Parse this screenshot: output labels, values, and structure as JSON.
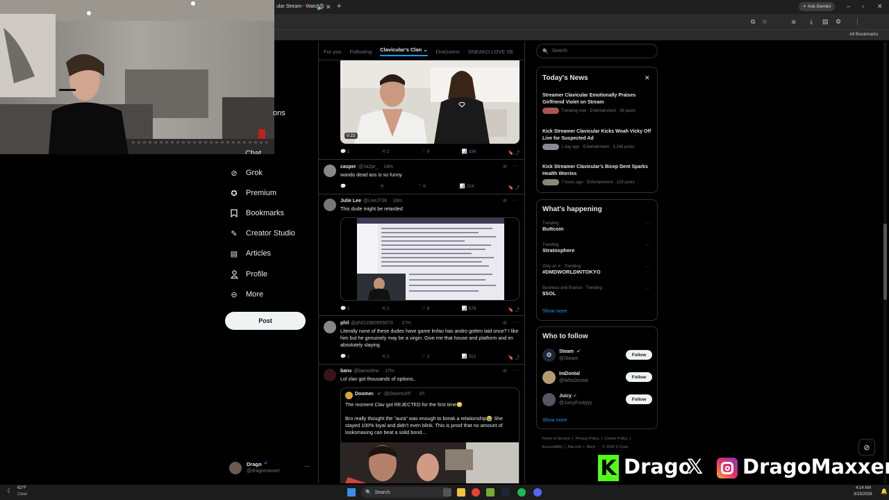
{
  "browser": {
    "tab_title": "ular Stream - Watch L",
    "ask_gemini": "Ask Gemini",
    "all_bookmarks": "All Bookmarks"
  },
  "sidebar": {
    "partial_item": "ons",
    "partial_item2": "Chat",
    "items": [
      {
        "label": "Grok",
        "icon": "grok-icon"
      },
      {
        "label": "Premium",
        "icon": "premium-icon"
      },
      {
        "label": "Bookmarks",
        "icon": "bookmark-icon"
      },
      {
        "label": "Creator Studio",
        "icon": "creator-studio-icon"
      },
      {
        "label": "Articles",
        "icon": "articles-icon"
      },
      {
        "label": "Profile",
        "icon": "profile-icon"
      },
      {
        "label": "More",
        "icon": "more-icon"
      }
    ],
    "post_label": "Post",
    "account": {
      "name": "Drago",
      "handle": "@dragomaxxer"
    }
  },
  "feed": {
    "tabs": [
      "For you",
      "Following",
      "Clavicular's Clan",
      "DraGoons",
      "SNEAKO LOVE SE"
    ],
    "video_time": "0:22",
    "first_actions": {
      "replies": "1",
      "reposts": "2",
      "likes": "9",
      "views": "336"
    },
    "tweets": [
      {
        "name": "casper",
        "handle": "@Ja2pr_",
        "time": "· 14m",
        "text": "wando dead ass is so funny",
        "actions": {
          "replies": "",
          "reposts": "",
          "likes": "6",
          "views": "224"
        }
      },
      {
        "name": "Julie Lee",
        "handle": "@LeeJ738",
        "time": "· 16m",
        "text": "This dude might be retarded",
        "actions": {
          "replies": "1",
          "reposts": "2",
          "likes": "8",
          "views": "678"
        }
      },
      {
        "name": "phil",
        "handle": "@phil12980955673",
        "time": "· 17m",
        "text": "Literally none of these dudes have game lmfao has andro gotten laid once? I like him but he genuinely may be a virgin. Give me that house and platform and im absolutely slaying",
        "actions": {
          "replies": "1",
          "reposts": "1",
          "likes": "2",
          "views": "312"
        }
      },
      {
        "name": "banx",
        "handle": "@banxolew",
        "time": "· 17m",
        "text": "Lol clav got thousands of options.."
      }
    ],
    "quote": {
      "name": "Doomer.",
      "handle": "@DoomsXP",
      "time": "· 1h",
      "line1": "The moment Clav got REJECTED for the first time😳",
      "line2": "Bro really thought the \"aura\" was enough to break a relationship😭 She stayed 100% loyal and didn't even blink. This is proof that no amount of looksmaxing can beat a solid bond..."
    }
  },
  "right": {
    "search_placeholder": "Search",
    "news_title": "Today's News",
    "news": [
      {
        "title": "Streamer Clavicular Emotionally Praises Girlfriend Violet on Stream",
        "meta": "Trending now · Entertainment · 36 posts"
      },
      {
        "title": "Kick Streamer Clavicular Kicks Woah Vicky Off Live for Suspected Ad",
        "meta": "1 day ago · Entertainment · 3,248 posts"
      },
      {
        "title": "Kick Streamer Clavicular's Bicep Dent Sparks Health Worries",
        "meta": "7 hours ago · Entertainment · 215 posts"
      }
    ],
    "happening_title": "What's happening",
    "trends": [
      {
        "meta": "Trending",
        "name": "Buttcoin"
      },
      {
        "meta": "Trending",
        "name": "Stratosphere"
      },
      {
        "meta": "Only on X · Trending",
        "name": "#DMDWORLDINTOKYO"
      },
      {
        "meta": "Business and finance · Trending",
        "name": "$SOL"
      }
    ],
    "show_more": "Show more",
    "wtf_title": "Who to follow",
    "follow": [
      {
        "name": "Steam",
        "handle": "@Steam"
      },
      {
        "name": "ImDontal",
        "handle": "@WhoDontal"
      },
      {
        "name": "Juicy",
        "handle": "@JuicyFruityyy"
      }
    ],
    "follow_label": "Follow",
    "footer1": "Terms of Service  |  Privacy Policy  |  Cookie Policy  |",
    "footer2": "Accessibility  |  Ads info  |  More ···  © 2026 X Corp."
  },
  "overlay": {
    "kick_name": "Drago",
    "ig_name": "DragoMaxxer"
  },
  "taskbar": {
    "temp": "62°F",
    "weather": "Clear",
    "search": "Search",
    "time": "4:14 AM",
    "date": "3/23/2026"
  },
  "colors": {
    "accent": "#1d9bf0",
    "kick": "#53fc18"
  }
}
